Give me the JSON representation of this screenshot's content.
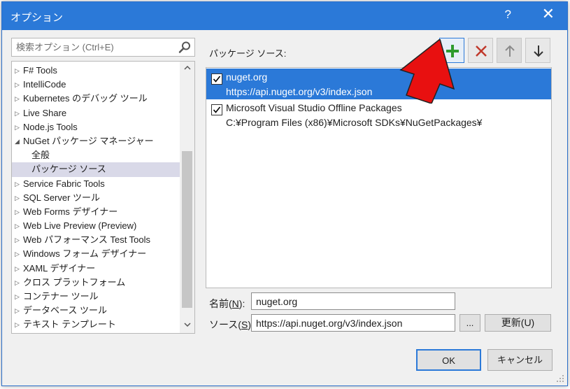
{
  "window": {
    "title": "オプション",
    "help": "?",
    "close": "✕"
  },
  "search": {
    "placeholder": "検索オプション (Ctrl+E)"
  },
  "tree": {
    "items": [
      {
        "label": "F# Tools",
        "expanded": false
      },
      {
        "label": "IntelliCode",
        "expanded": false
      },
      {
        "label": "Kubernetes のデバッグ ツール",
        "expanded": false
      },
      {
        "label": "Live Share",
        "expanded": false
      },
      {
        "label": "Node.js Tools",
        "expanded": false
      },
      {
        "label": "NuGet パッケージ マネージャー",
        "expanded": true
      },
      {
        "label": "全般",
        "child": true
      },
      {
        "label": "パッケージ ソース",
        "child": true,
        "selected": true
      },
      {
        "label": "Service Fabric Tools",
        "expanded": false
      },
      {
        "label": "SQL Server ツール",
        "expanded": false
      },
      {
        "label": "Web Forms デザイナー",
        "expanded": false
      },
      {
        "label": "Web Live Preview (Preview)",
        "expanded": false
      },
      {
        "label": "Web パフォーマンス Test Tools",
        "expanded": false
      },
      {
        "label": "Windows フォーム デザイナー",
        "expanded": false
      },
      {
        "label": "XAML デザイナー",
        "expanded": false
      },
      {
        "label": "クロス プラットフォーム",
        "expanded": false
      },
      {
        "label": "コンテナー ツール",
        "expanded": false
      },
      {
        "label": "データベース ツール",
        "expanded": false
      },
      {
        "label": "テキスト テンプレート",
        "expanded": false
      }
    ]
  },
  "sources_panel": {
    "label": "パッケージ ソース:",
    "sources": [
      {
        "name": "nuget.org",
        "url": "https://api.nuget.org/v3/index.json",
        "checked": true,
        "selected": true
      },
      {
        "name": "Microsoft Visual Studio Offline Packages",
        "url": "C:¥Program Files (x86)¥Microsoft SDKs¥NuGetPackages¥",
        "checked": true,
        "selected": false
      }
    ]
  },
  "form": {
    "name_label_pre": "名前(",
    "name_label_key": "N",
    "name_label_post": "):",
    "name_value": "nuget.org",
    "source_label_pre": "ソース(",
    "source_label_key": "S",
    "source_label_post": "):",
    "source_value": "https://api.nuget.org/v3/index.json",
    "browse_label": "...",
    "update_label": "更新(U)"
  },
  "buttons": {
    "ok": "OK",
    "cancel": "キャンセル"
  },
  "colors": {
    "title_bar": "#2b79d8",
    "selection": "#2b79d8",
    "add_icon": "#2e9b2e",
    "remove_icon": "#c0392b",
    "callout_arrow": "#e81010"
  },
  "icons": {
    "add": "plus-icon",
    "remove": "x-icon",
    "up": "arrow-up-icon",
    "down": "arrow-down-icon",
    "search": "magnifier-icon"
  }
}
